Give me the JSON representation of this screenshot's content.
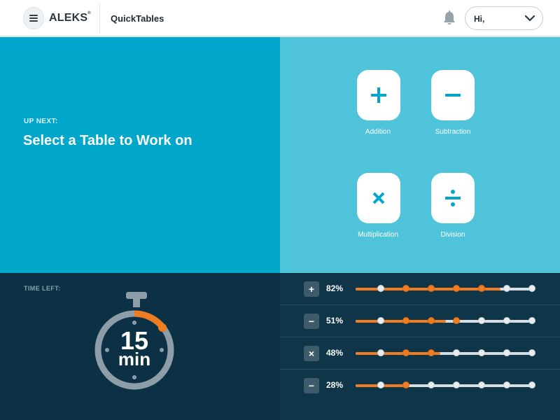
{
  "header": {
    "logo_text": "ALEKS",
    "logo_mark": "®",
    "app_title": "QuickTables",
    "greeting": "Hi,",
    "menu_icon": "hamburger-icon",
    "notification_icon": "bell-icon",
    "dropdown_icon": "chevron-down-icon"
  },
  "hero": {
    "up_next_label": "UP NEXT:",
    "headline": "Select a Table to Work on"
  },
  "operations": [
    {
      "label": "Addition",
      "icon": "plus-icon",
      "symbol": "+"
    },
    {
      "label": "Subtraction",
      "icon": "minus-icon",
      "symbol": "−"
    },
    {
      "label": "Multiplication",
      "icon": "times-icon",
      "symbol": "×"
    },
    {
      "label": "Division",
      "icon": "divide-icon",
      "symbol": "÷"
    }
  ],
  "timer": {
    "label": "TIME LEFT:",
    "minutes": "15",
    "unit": "min"
  },
  "progress": [
    {
      "symbol": "+",
      "percent_label": "82%",
      "percent": 82,
      "completed_dots": 4,
      "total_dots": 7
    },
    {
      "symbol": "−",
      "percent_label": "51%",
      "percent": 51,
      "completed_dots": 3,
      "total_dots": 7
    },
    {
      "symbol": "×",
      "percent_label": "48%",
      "percent": 48,
      "completed_dots": 2,
      "total_dots": 7
    },
    {
      "symbol": "−",
      "percent_label": "28%",
      "percent": 28,
      "completed_dots": 1,
      "total_dots": 7
    }
  ],
  "colors": {
    "primary_blue": "#00a7ca",
    "light_blue": "#4fc3da",
    "dark_navy": "#0c3044",
    "accent_orange": "#f07c22"
  }
}
